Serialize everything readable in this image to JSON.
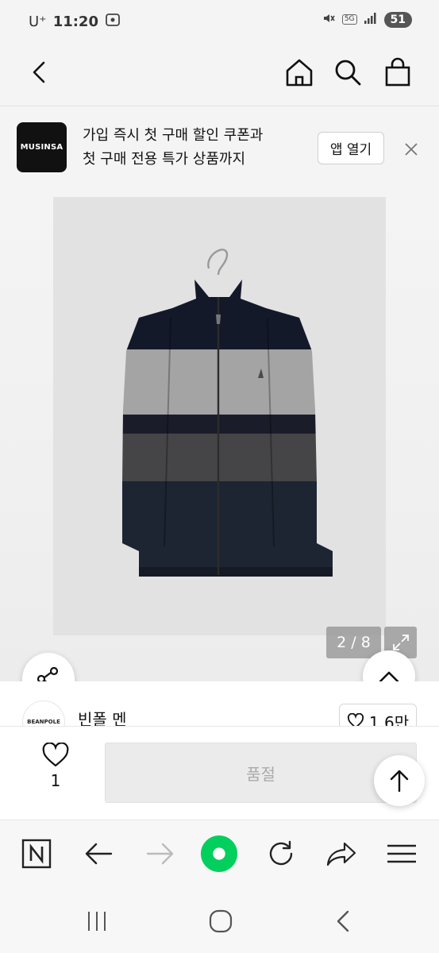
{
  "status_bar": {
    "carrier": "U⁺",
    "time": "11:20",
    "network": "5G",
    "battery": "51"
  },
  "header": {
    "back_icon": "chevron-left-icon",
    "home_icon": "home-icon",
    "search_icon": "search-icon",
    "cart_icon": "shopping-bag-icon"
  },
  "banner": {
    "logo_text": "MUSINSA",
    "line1": "가입 즉시 첫 구매 할인 쿠폰과",
    "line2": "첫 구매 전용 특가 상품까지",
    "open_app_label": "앱 열기"
  },
  "gallery": {
    "counter": "2 / 8",
    "current": 2,
    "total": 8
  },
  "brand": {
    "logo_text": "BEANPOLE",
    "name": "빈폴 멘",
    "likes": "1.6만"
  },
  "purchase": {
    "like_count": "1",
    "soldout_label": "품절"
  },
  "browser_toolbar": {
    "items": [
      "naver-n-icon",
      "back-arrow-icon",
      "forward-arrow-icon",
      "green-dot-icon",
      "refresh-icon",
      "share-icon",
      "menu-icon"
    ]
  },
  "colors": {
    "accent_green": "#03cf5d",
    "brand_black": "#111111",
    "soldout_gray": "#ebebeb"
  }
}
